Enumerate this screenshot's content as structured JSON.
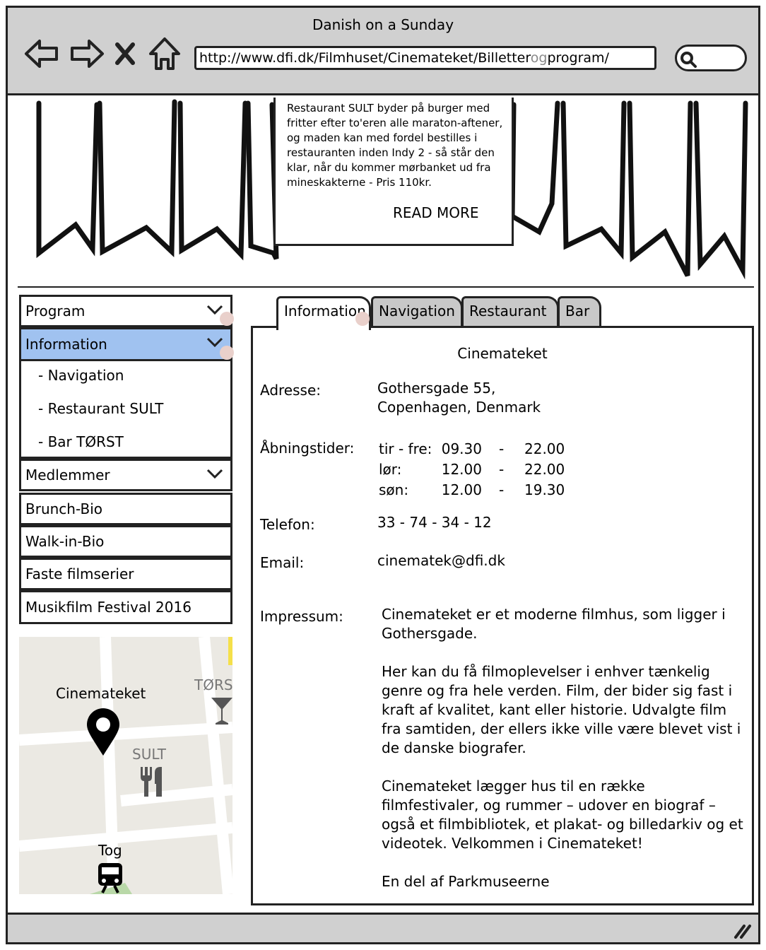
{
  "window": {
    "title": "Danish on a Sunday",
    "url_prefix": "http://www.dfi.dk/Filmhuset/Cinemateket/Billetter",
    "url_highlight": "og",
    "url_suffix": "program/"
  },
  "hero": {
    "card_text": "Restaurant SULT byder på burger med fritter efter to'eren alle maraton-aftener, og maden kan med fordel bestilles i restauranten inden Indy 2 - så står den klar, når du kommer mørbanket ud fra mineskakterne - Pris 110kr.",
    "read_more": "READ MORE"
  },
  "sidebar": {
    "program": "Program",
    "information": "Information",
    "subitems": [
      "- Navigation",
      "- Restaurant SULT",
      "- Bar TØRST"
    ],
    "medlemmer": "Medlemmer",
    "items": [
      "Brunch-Bio",
      "Walk-in-Bio",
      "Faste filmserier",
      "Musikfilm Festival 2016"
    ]
  },
  "map": {
    "cinemateket": "Cinemateket",
    "torst": "TØRS",
    "sult": "SULT",
    "tog": "Tog"
  },
  "tabs": [
    "Information",
    "Navigation",
    "Restaurant",
    "Bar"
  ],
  "info": {
    "heading": "Cinemateket",
    "address_label": "Adresse:",
    "address_line1": "Gothersgade 55,",
    "address_line2": "Copenhagen, Denmark",
    "hours_label": "Åbningstider:",
    "hours": [
      {
        "day": "tir - fre:",
        "open": "09.30",
        "sep": "-",
        "close": "22.00"
      },
      {
        "day": "lør:",
        "open": "12.00",
        "sep": "-",
        "close": "22.00"
      },
      {
        "day": "søn:",
        "open": "12.00",
        "sep": "-",
        "close": "19.30"
      }
    ],
    "phone_label": "Telefon:",
    "phone": "33 - 74 - 34 - 12",
    "email_label": "Email:",
    "email": "cinematek@dfi.dk",
    "impressum_label": "Impressum:",
    "impressum": [
      "Cinemateket er et moderne filmhus, som ligger i Gothersgade.",
      "Her kan du få filmoplevelser i enhver tænkelig genre og fra hele verden. Film, der bider sig fast i kraft af kvalitet, kant eller historie. Udvalgte film fra samtiden, der ellers ikke ville være blevet vist i de danske biografer.",
      "Cinemateket lægger hus til en række filmfestivaler, og rummer – udover en biograf – også et filmbibliotek, et plakat- og billedarkiv og et videotek. Velkommen i Cinemateket!",
      "En del af Parkmuseerne"
    ]
  },
  "colors": {
    "selected": "#a0c2f0",
    "chrome": "#d0d0d0",
    "map_bg": "#ebe9e3"
  }
}
